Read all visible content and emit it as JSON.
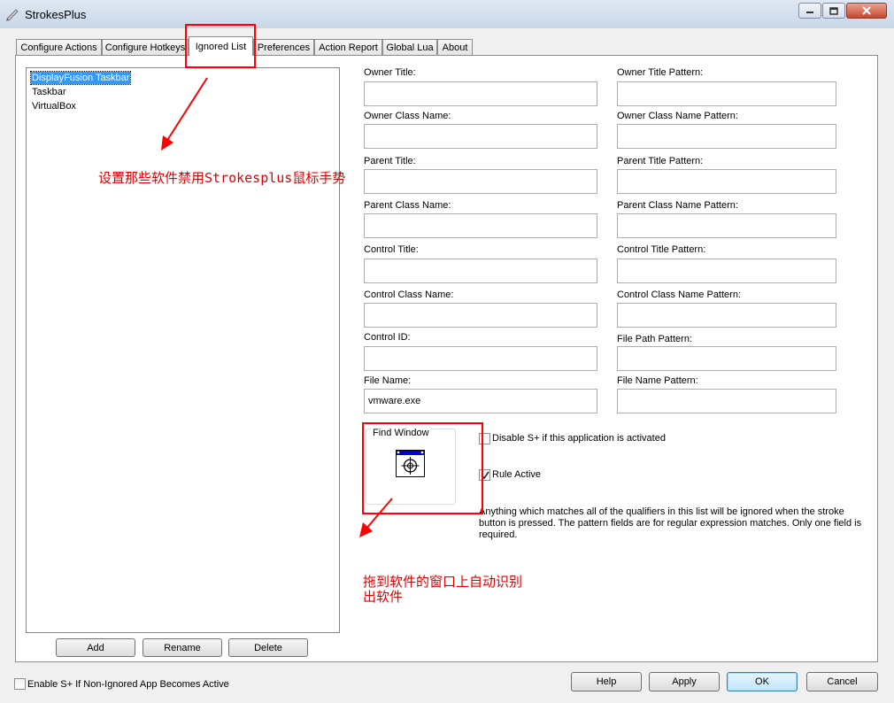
{
  "window": {
    "title": "StrokesPlus",
    "controls": [
      "minimize-icon",
      "maximize-icon",
      "close-icon"
    ]
  },
  "tabs": [
    {
      "label": "Configure Actions",
      "active": false
    },
    {
      "label": "Configure Hotkeys",
      "active": false
    },
    {
      "label": "Ignored List",
      "active": true
    },
    {
      "label": "Preferences",
      "active": false
    },
    {
      "label": "Action Report",
      "active": false
    },
    {
      "label": "Global Lua",
      "active": false
    },
    {
      "label": "About",
      "active": false
    }
  ],
  "ignored_list": {
    "items": [
      "DisplayFusion Taskbar",
      "Taskbar",
      "VirtualBox"
    ],
    "selected_index": 0,
    "add_label": "Add",
    "rename_label": "Rename",
    "delete_label": "Delete"
  },
  "fields": {
    "owner_title": {
      "label": "Owner Title:",
      "value": ""
    },
    "owner_title_pattern": {
      "label": "Owner Title Pattern:",
      "value": ""
    },
    "owner_class_name": {
      "label": "Owner Class Name:",
      "value": ""
    },
    "owner_class_name_pattern": {
      "label": "Owner Class Name Pattern:",
      "value": ""
    },
    "parent_title": {
      "label": "Parent Title:",
      "value": ""
    },
    "parent_title_pattern": {
      "label": "Parent Title Pattern:",
      "value": ""
    },
    "parent_class_name": {
      "label": "Parent Class Name:",
      "value": ""
    },
    "parent_class_name_pattern": {
      "label": "Parent Class Name Pattern:",
      "value": ""
    },
    "control_title": {
      "label": "Control Title:",
      "value": ""
    },
    "control_title_pattern": {
      "label": "Control Title Pattern:",
      "value": ""
    },
    "control_class_name": {
      "label": "Control Class Name:",
      "value": ""
    },
    "control_class_name_pattern": {
      "label": "Control Class Name Pattern:",
      "value": ""
    },
    "control_id": {
      "label": "Control ID:",
      "value": ""
    },
    "file_path_pattern": {
      "label": "File Path Pattern:",
      "value": ""
    },
    "file_name": {
      "label": "File Name:",
      "value": "vmware.exe"
    },
    "file_name_pattern": {
      "label": "File Name Pattern:",
      "value": ""
    }
  },
  "find_window": {
    "label": "Find Window",
    "icon": "crosshair-target-icon"
  },
  "options": {
    "disable_label": "Disable S+ if this application is activated",
    "disable_checked": false,
    "rule_active_label": "Rule Active",
    "rule_active_checked": true,
    "description": "Anything which matches all of the qualifiers in this list will be ignored when the stroke button is pressed. The pattern fields are for regular expression matches. Only one field is required."
  },
  "footer": {
    "enable_label": "Enable S+ If Non-Ignored App Becomes Active",
    "enable_checked": false,
    "help_label": "Help",
    "apply_label": "Apply",
    "ok_label": "OK",
    "cancel_label": "Cancel"
  },
  "annotations": {
    "list_note": "设置那些软件禁用Strokesplus鼠标手势",
    "finder_note_line1": "拖到软件的窗口上自动识别",
    "finder_note_line2": "出软件",
    "color": "#ff0000"
  }
}
